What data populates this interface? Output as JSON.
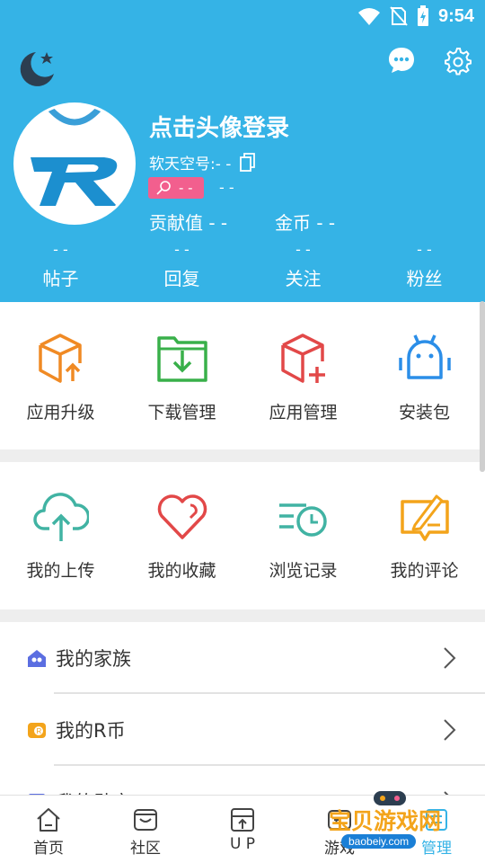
{
  "status": {
    "time": "9:54"
  },
  "header": {
    "login_title": "点击头像登录",
    "soft_id_label": "软天空号:- -",
    "badge_value": "- -",
    "badge_extra": "- -",
    "contribution": "贡献值 - -",
    "coins": "金币 - -"
  },
  "counts": [
    {
      "value": "- -",
      "label": "帖子"
    },
    {
      "value": "- -",
      "label": "回复"
    },
    {
      "value": "- -",
      "label": "关注"
    },
    {
      "value": "- -",
      "label": "粉丝"
    }
  ],
  "grid1": [
    {
      "label": "应用升级",
      "icon": "box-upgrade-icon"
    },
    {
      "label": "下载管理",
      "icon": "download-folder-icon"
    },
    {
      "label": "应用管理",
      "icon": "box-add-icon"
    },
    {
      "label": "安装包",
      "icon": "android-icon"
    }
  ],
  "grid2": [
    {
      "label": "我的上传",
      "icon": "cloud-upload-icon"
    },
    {
      "label": "我的收藏",
      "icon": "heart-icon"
    },
    {
      "label": "浏览记录",
      "icon": "history-icon"
    },
    {
      "label": "我的评论",
      "icon": "comment-edit-icon"
    }
  ],
  "list": [
    {
      "label": "我的家族",
      "icon": "family-house-icon"
    },
    {
      "label": "我的R币",
      "icon": "coin-icon"
    },
    {
      "label": "我的勋章",
      "icon": "medal-icon"
    }
  ],
  "bottom_nav": [
    {
      "label": "首页",
      "icon": "home-icon",
      "active": false
    },
    {
      "label": "社区",
      "icon": "community-icon",
      "active": false
    },
    {
      "label": "U P",
      "icon": "upload-up-icon",
      "active": false
    },
    {
      "label": "游戏",
      "icon": "game-icon",
      "active": false
    },
    {
      "label": "管理",
      "icon": "manage-icon",
      "active": true
    }
  ],
  "watermark": {
    "text": "宝贝游戏网",
    "url": "baobeiy.com"
  },
  "colors": {
    "primary": "#35b3e6",
    "orange": "#f08a24",
    "green": "#39b04a",
    "red": "#e24848",
    "blue": "#2b8ee8",
    "teal": "#41b3a3",
    "pink": "#f25f8e"
  }
}
